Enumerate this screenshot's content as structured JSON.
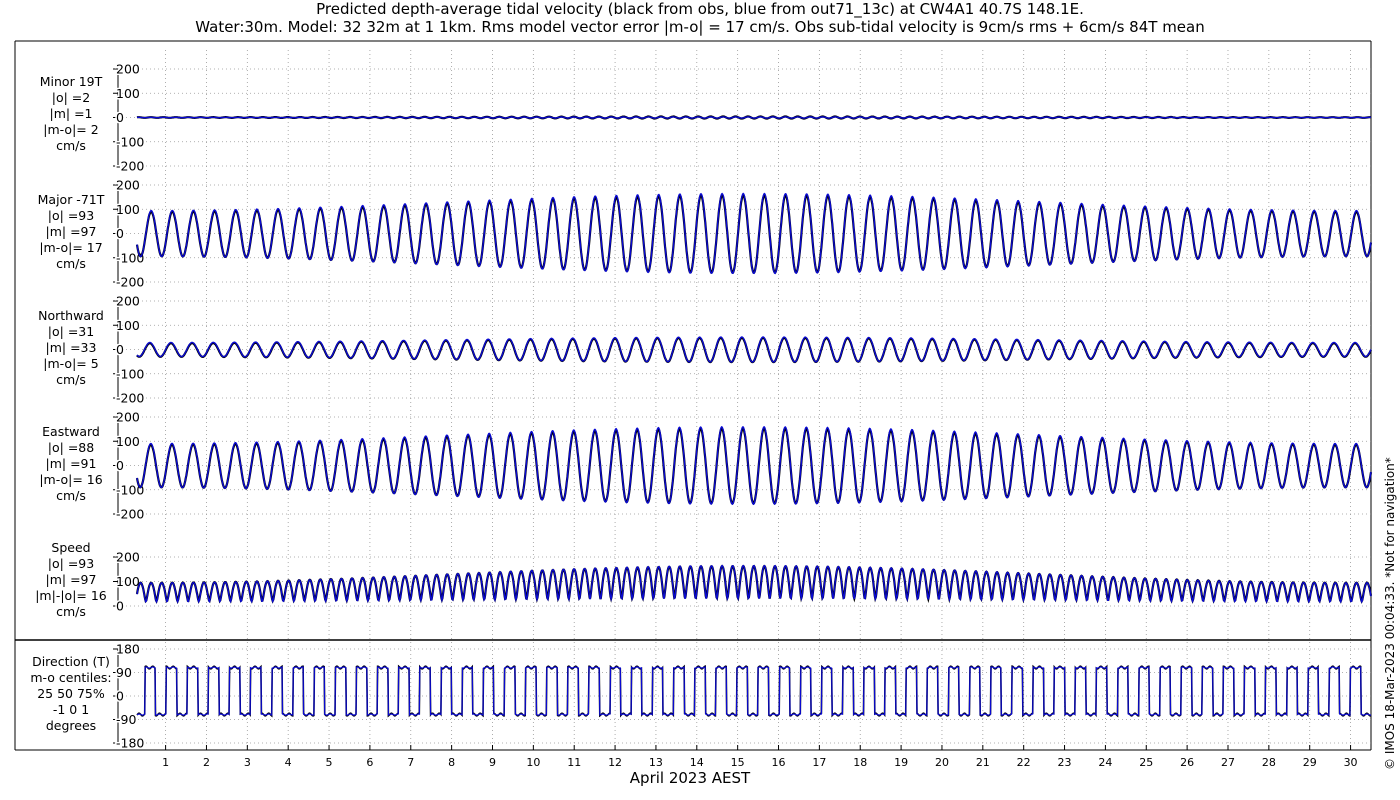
{
  "title_line1": "Predicted depth-average tidal velocity (black from obs, blue from out71_13c) at CW4A1 40.7S 148.1E.",
  "title_line2": "Water:30m. Model: 32 32m at 1 1km. Rms model vector error |m-o| = 17 cm/s. Obs sub-tidal velocity is 9cm/s rms + 6cm/s 84T mean",
  "credit": "© IMOS 18-Mar-2023 00:04:33. *Not for navigation*",
  "colors": {
    "obs": "#000000",
    "model": "#0a0ad2"
  },
  "chart_data": {
    "type": "line",
    "xlabel": "April 2023 AEST",
    "x_ticks": [
      "1",
      "2",
      "3",
      "4",
      "5",
      "6",
      "7",
      "8",
      "9",
      "10",
      "11",
      "12",
      "13",
      "14",
      "15",
      "16",
      "17",
      "18",
      "19",
      "20",
      "21",
      "22",
      "23",
      "24",
      "25",
      "26",
      "27",
      "28",
      "29",
      "30"
    ],
    "xlim": [
      0.3,
      30.5
    ],
    "grid": true,
    "series_names": [
      "obs",
      "out71_13c"
    ],
    "panels": [
      {
        "id": "minor",
        "label_lines": [
          "Minor 19T",
          "|o| =2",
          "|m| =1",
          "|m-o|= 2",
          "cm/s"
        ],
        "ylim": [
          -200,
          200
        ],
        "yticks": [
          200,
          100,
          0,
          -100,
          -200
        ],
        "tick_labels": [
          "200",
          "100",
          "0",
          "-100",
          "-200"
        ],
        "signal": "minor",
        "amp_min": 2,
        "amp_max": 6
      },
      {
        "id": "major",
        "label_lines": [
          "Major -71T",
          "|o| =93",
          "|m| =97",
          "|m-o|= 17",
          "cm/s"
        ],
        "ylim": [
          -200,
          200
        ],
        "yticks": [
          200,
          100,
          0,
          -100,
          -200
        ],
        "tick_labels": [
          "200",
          "100",
          "0",
          "-100",
          "-200"
        ],
        "signal": "sine",
        "amp_min": 92,
        "amp_max": 160,
        "phase": 0
      },
      {
        "id": "northward",
        "label_lines": [
          "Northward",
          "|o| =31",
          "|m| =33",
          "|m-o|= 5",
          "cm/s"
        ],
        "ylim": [
          -200,
          200
        ],
        "yticks": [
          200,
          100,
          0,
          -100,
          -200
        ],
        "tick_labels": [
          "200",
          "100",
          "0",
          "-100",
          "-200"
        ],
        "signal": "sine",
        "amp_min": 28,
        "amp_max": 50,
        "phase": 0.4
      },
      {
        "id": "eastward",
        "label_lines": [
          "Eastward",
          "|o| =88",
          "|m| =91",
          "|m-o|= 16",
          "cm/s"
        ],
        "ylim": [
          -200,
          200
        ],
        "yticks": [
          200,
          100,
          0,
          -100,
          -200
        ],
        "tick_labels": [
          "200",
          "100",
          "0",
          "-100",
          "-200"
        ],
        "signal": "sine",
        "amp_min": 88,
        "amp_max": 155,
        "phase": 0.1
      },
      {
        "id": "speed",
        "label_lines": [
          "Speed",
          "|o| =93",
          "|m| =97",
          "|m|-|o|= 16",
          "cm/s"
        ],
        "ylim": [
          0,
          200
        ],
        "yticks": [
          200,
          100,
          0
        ],
        "tick_labels": [
          "200",
          "100",
          "0"
        ],
        "signal": "speed",
        "amp_min": 92,
        "amp_max": 160,
        "phase": 0
      },
      {
        "id": "direction",
        "label_lines": [
          "Direction (T)",
          "m-o centiles:",
          "25  50  75%",
          "-1  0  1",
          "degrees"
        ],
        "ylim": [
          -180,
          180
        ],
        "yticks": [
          180,
          90,
          0,
          -90,
          -180
        ],
        "tick_labels": [
          "180",
          "90",
          "0",
          "-90",
          "-180"
        ],
        "signal": "direction",
        "high": 109,
        "low": -71
      }
    ]
  }
}
